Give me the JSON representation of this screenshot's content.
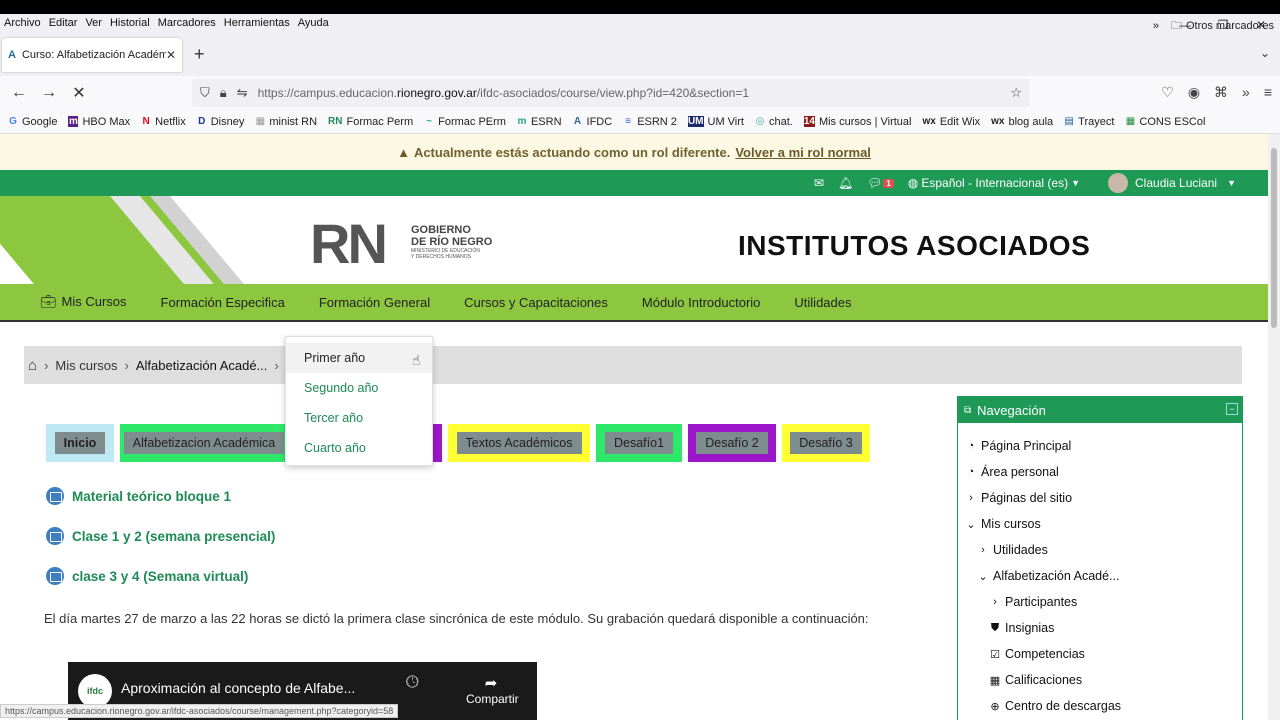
{
  "menu": [
    "Archivo",
    "Editar",
    "Ver",
    "Historial",
    "Marcadores",
    "Herramientas",
    "Ayuda"
  ],
  "window_controls": {
    "minimize": "—",
    "restore": "❐",
    "close": "✕"
  },
  "tab": {
    "title": "Curso: Alfabetización Académ",
    "close": "✕",
    "new": "+",
    "overflow": "⌄",
    "favicon": "A"
  },
  "nav": {
    "back": "←",
    "forward": "→",
    "reload": "✕"
  },
  "url": {
    "prefix": "https://campus.educacion.",
    "host": "rionegro.gov.ar",
    "path": "/ifdc-asociados/course/view.php?id=420&section=1"
  },
  "toolbar_icons": [
    "shield-icon",
    "lock-icon",
    "star-icon",
    "pocket-icon",
    "account-icon",
    "extensions-icon",
    "overflow-icon",
    "menu-icon"
  ],
  "bookmarks": [
    {
      "icon": "G",
      "label": "Google"
    },
    {
      "icon": "m",
      "label": "HBO Max"
    },
    {
      "icon": "N",
      "label": "Netflix"
    },
    {
      "icon": "D",
      "label": "Disney"
    },
    {
      "icon": "▦",
      "label": "minist RN"
    },
    {
      "icon": "RN",
      "label": "Formac Perm"
    },
    {
      "icon": "~",
      "label": "Formac PErm"
    },
    {
      "icon": "m",
      "label": "ESRN"
    },
    {
      "icon": "A",
      "label": "IFDC"
    },
    {
      "icon": "≡",
      "label": "ESRN 2"
    },
    {
      "icon": "UM",
      "label": "UM  Virt"
    },
    {
      "icon": "◎",
      "label": "chat."
    },
    {
      "icon": "14",
      "label": "Mis cursos | Virtual"
    },
    {
      "icon": "wx",
      "label": "Edit  Wix"
    },
    {
      "icon": "wx",
      "label": "blog aula"
    },
    {
      "icon": "▤",
      "label": "Trayect"
    },
    {
      "icon": "▦",
      "label": "CONS ESCol"
    }
  ],
  "bookmarks_more": "»",
  "bookmarks_other": "Otros marcadores",
  "role_notice": {
    "text": "Actualmente estás actuando como un rol diferente.",
    "link": "Volver a mi rol normal"
  },
  "userbar": {
    "language": "Español - Internacional (es)",
    "user": "Claudia Luciani",
    "message_count": "1"
  },
  "banner": {
    "logo": "RN",
    "gov_line1": "GOBIERNO",
    "gov_line2": "DE RÍO NEGRO",
    "gov_sub1": "MINISTERIO DE EDUCACIÓN",
    "gov_sub2": "Y DERECHOS HUMANOS",
    "title": "INSTITUTOS ASOCIADOS"
  },
  "main_nav": [
    "Mis Cursos",
    "Formación Especifica",
    "Formación General",
    "Cursos y Capacitaciones",
    "Módulo Introductorio",
    "Utilidades"
  ],
  "dropdown": [
    "Primer año",
    "Segundo año",
    "Tercer año",
    "Cuarto año"
  ],
  "breadcrumb": [
    "Mis cursos",
    "Alfabetización Acadé..."
  ],
  "course_tabs": [
    {
      "label": "Inicio",
      "bg": "#bfe8f5"
    },
    {
      "label": "Alfabetizacion Académica",
      "bg": "#2ee86a"
    },
    {
      "label": "",
      "bg": "#9b16c9"
    },
    {
      "label": "Textos Académicos",
      "bg": "#ffff33"
    },
    {
      "label": "Desafío1",
      "bg": "#2ee86a"
    },
    {
      "label": "Desafío 2",
      "bg": "#9b16c9"
    },
    {
      "label": "Desafío 3",
      "bg": "#ffff33"
    }
  ],
  "sections": [
    "Material teórico bloque 1",
    "Clase 1 y 2 (semana presencial)",
    "clase 3 y 4 (Semana virtual)"
  ],
  "paragraph": "El día martes 27 de marzo a las 22 horas  se dictó la primera clase sincrónica de este módulo. Su grabación quedará disponible a continuación:",
  "video": {
    "logo": "ifdc",
    "title": "Aproximación al concepto de Alfabe...",
    "share": "Compartir"
  },
  "status_url": "https://campus.educacion.rionegro.gov.ar/ifdc-asociados/course/management.php?categoryid=58",
  "navigation": {
    "title": "Navegación",
    "items": [
      "Página Principal",
      "Área personal",
      "Páginas del sitio",
      "Mis cursos",
      "Utilidades",
      "Alfabetización Acadé...",
      "Participantes",
      "Insignias",
      "Competencias",
      "Calificaciones",
      "Centro de descargas"
    ]
  }
}
